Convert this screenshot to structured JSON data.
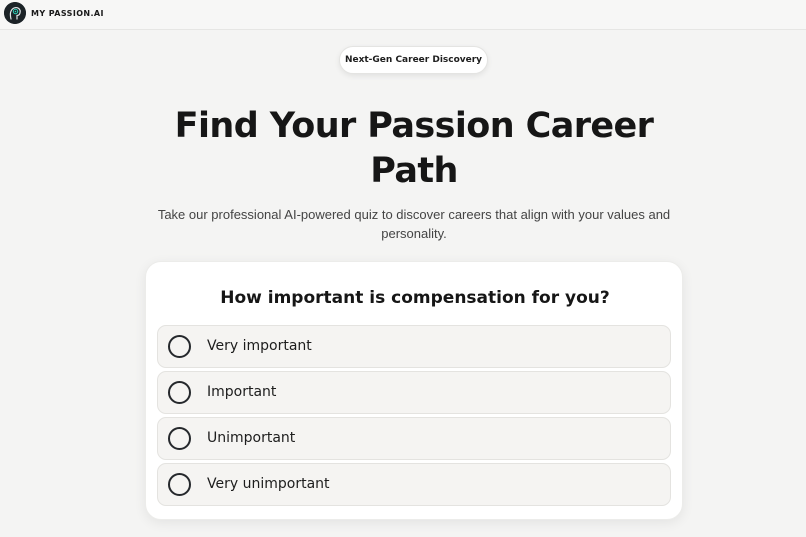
{
  "header": {
    "brand": "MY PASSION.AI",
    "logo_icon": "brain-head-icon"
  },
  "hero": {
    "badge": "Next-Gen Career Discovery",
    "title": "Find Your Passion Career Path",
    "subtitle": "Take our professional AI-powered quiz to discover careers that align with your values and personality."
  },
  "quiz": {
    "question": "How important is compensation for you?",
    "options": [
      {
        "label": "Very important",
        "selected": false
      },
      {
        "label": "Important",
        "selected": false
      },
      {
        "label": "Unimportant",
        "selected": false
      },
      {
        "label": "Very unimportant",
        "selected": false
      }
    ]
  },
  "colors": {
    "background": "#f4f4f3",
    "card": "#ffffff",
    "option_bg": "#f5f4f2",
    "text": "#161616",
    "logo_accent": "#2bd0b8"
  }
}
